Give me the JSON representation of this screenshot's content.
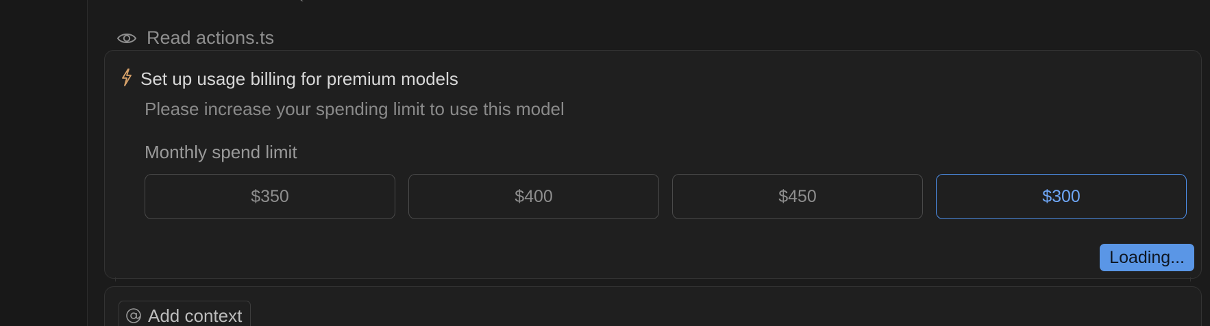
{
  "tool_calls": [
    {
      "icon": "eye-icon",
      "label": "Read actions.ts"
    }
  ],
  "billing": {
    "icon": "lightning-icon",
    "title": "Set up usage billing for premium models",
    "subtitle": "Please increase your spending limit to use this model",
    "limit_label": "Monthly spend limit",
    "options": [
      {
        "label": "$350",
        "selected": false
      },
      {
        "label": "$400",
        "selected": false
      },
      {
        "label": "$450",
        "selected": false
      },
      {
        "label": "$300",
        "selected": true
      }
    ],
    "action_label": "Loading..."
  },
  "composer": {
    "add_context_icon": "at-sign-icon",
    "add_context_label": "Add context"
  },
  "colors": {
    "accent": "#4d8ee8",
    "lightning": "#d9a36a",
    "background": "#1b1b1b"
  }
}
